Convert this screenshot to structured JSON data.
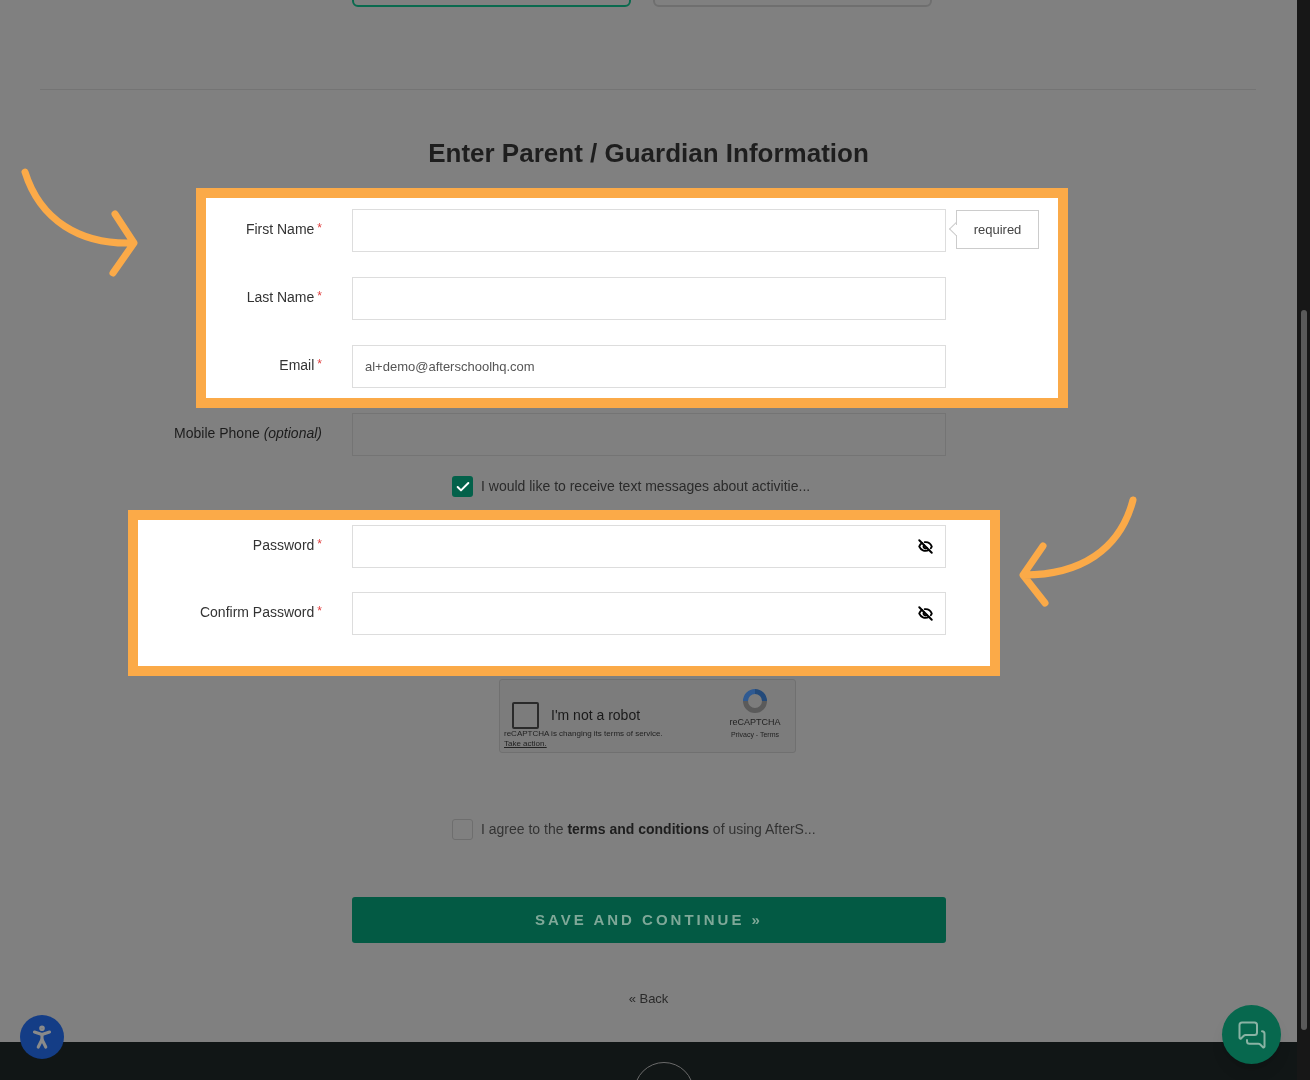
{
  "top_buttons": [
    {
      "selected": true
    },
    {
      "selected": false
    }
  ],
  "heading": "Enter Parent / Guardian Information",
  "highlight_1": {
    "fields": [
      {
        "label": "First Name",
        "required_mark": "*",
        "tooltip": "required"
      },
      {
        "label": "Last Name",
        "required_mark": "*"
      },
      {
        "label": "Email",
        "required_mark": "*",
        "value": "al+demo@afterschoolhq.com"
      }
    ]
  },
  "mobile_field": {
    "label": "Mobile Phone *(optional)*"
  },
  "sms_optin": {
    "label": "I would like to receive text messages about activitie...",
    "checked": true
  },
  "highlight_2": {
    "fields": [
      {
        "label": "Password",
        "required_mark": "*",
        "kind": "password"
      },
      {
        "label": "Confirm Password",
        "required_mark": "*",
        "kind": "password"
      }
    ]
  },
  "recaptcha": {
    "label": "I'm not a robot",
    "checked": false,
    "notice": "reCAPTCHA is changing its terms of service.",
    "notice_link": "Take action.",
    "brand": "reCAPTCHA",
    "links": "Privacy - Terms"
  },
  "terms": {
    "label": "I agree to the **terms and conditions** of using AfterS...",
    "checked": false
  },
  "save_button": "SAVE AND CONTINUE »",
  "back_link": "« Back"
}
